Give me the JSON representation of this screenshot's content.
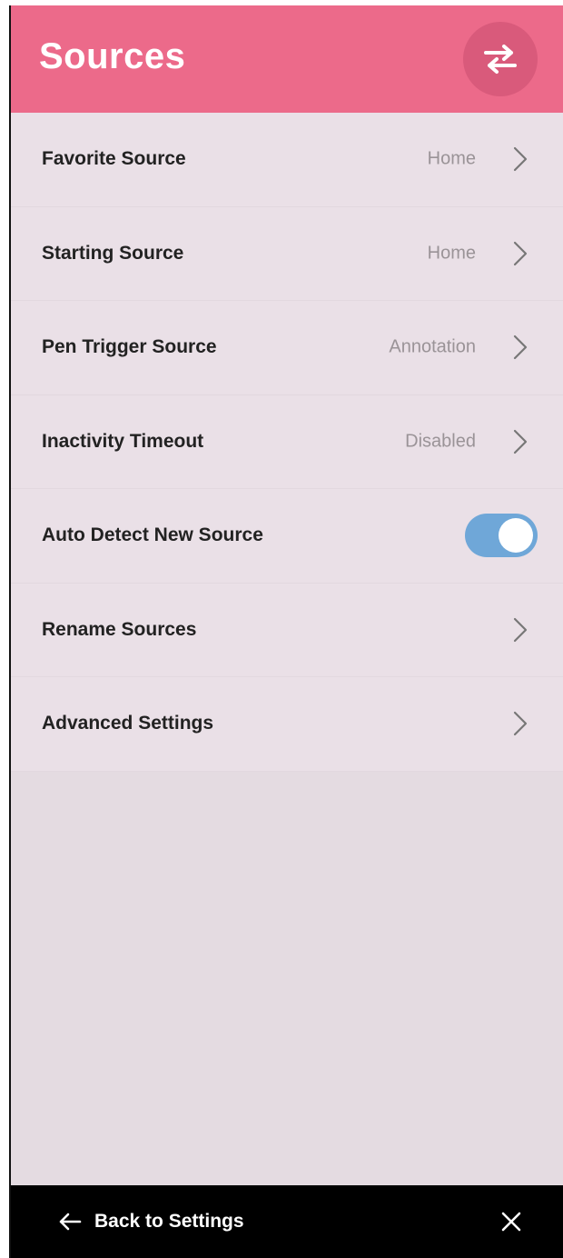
{
  "header": {
    "title": "Sources",
    "swap_icon": "swap-arrows-icon",
    "color": "#ec6a8a"
  },
  "rows": [
    {
      "label": "Favorite Source",
      "value": "Home",
      "type": "chevron"
    },
    {
      "label": "Starting Source",
      "value": "Home",
      "type": "chevron"
    },
    {
      "label": "Pen Trigger Source",
      "value": "Annotation",
      "type": "chevron"
    },
    {
      "label": "Inactivity Timeout",
      "value": "Disabled",
      "type": "chevron"
    },
    {
      "label": "Auto Detect New Source",
      "value": "",
      "type": "toggle",
      "toggle_on": true
    },
    {
      "label": "Rename Sources",
      "value": "",
      "type": "chevron"
    },
    {
      "label": "Advanced Settings",
      "value": "",
      "type": "chevron"
    }
  ],
  "footer": {
    "back_label": "Back to Settings",
    "back_icon": "arrow-left-icon",
    "close_icon": "close-icon"
  },
  "colors": {
    "toggle_on": "#6fa7d8",
    "panel_bg": "#e4dbe1"
  }
}
